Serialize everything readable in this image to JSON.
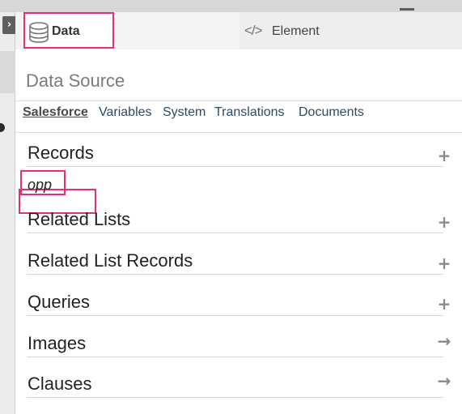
{
  "tabs": {
    "data_label": "Data",
    "element_label": "Element"
  },
  "data_source": {
    "title": "Data Source",
    "subtabs": [
      {
        "label": "Salesforce",
        "active": true
      },
      {
        "label": "Variables",
        "active": false
      },
      {
        "label": "System",
        "active": false
      },
      {
        "label": "Translations",
        "active": false
      },
      {
        "label": "Documents",
        "active": false
      }
    ]
  },
  "groups": [
    {
      "label": "Records",
      "action": "+",
      "action_icon": "plus-icon",
      "items": [
        "opp"
      ]
    },
    {
      "label": "Related Lists",
      "action": "+",
      "action_icon": "plus-icon",
      "items": []
    },
    {
      "label": "Related List Records",
      "action": "+",
      "action_icon": "plus-icon",
      "items": []
    },
    {
      "label": "Queries",
      "action": "+",
      "action_icon": "plus-icon",
      "items": []
    },
    {
      "label": "Images",
      "action": "→",
      "action_icon": "arrow-right-icon",
      "items": []
    },
    {
      "label": "Clauses",
      "action": "→",
      "action_icon": "arrow-right-icon",
      "items": []
    }
  ],
  "collapse_icon": "›",
  "colors": {
    "highlight": "#e5336a",
    "link": "#2e4a63",
    "muted": "#7b7b7b"
  }
}
